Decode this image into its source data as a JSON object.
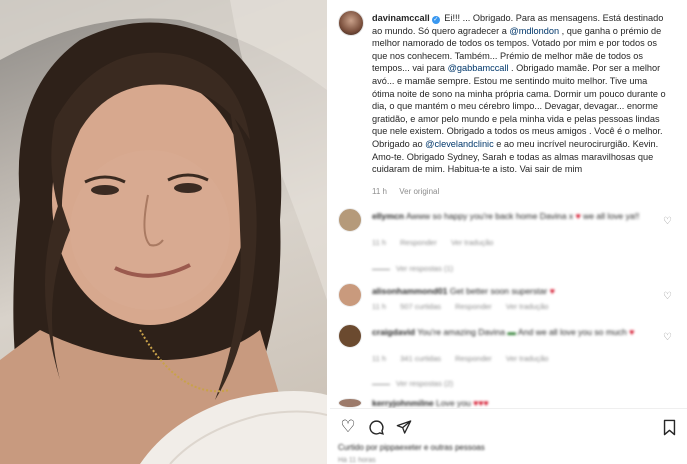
{
  "post": {
    "username": "davinamccall",
    "caption_parts": [
      {
        "type": "text",
        "value": " Ei!!! ... Obrigado. Para as mensagens. Está destinado ao mundo. Só quero agradecer a "
      },
      {
        "type": "mention",
        "value": "@mdlondon"
      },
      {
        "type": "text",
        "value": " , que ganha o prémio de melhor namorado de todos os tempos. Votado por mim e por todos os que nos conhecem. Também... Prémio de melhor mãe de todos os tempos... vai para "
      },
      {
        "type": "mention",
        "value": "@gabbamccall"
      },
      {
        "type": "text",
        "value": " . Obrigado mamãe. Por ser a melhor avó... e mamãe sempre. Estou me sentindo muito melhor. Tive uma ótima noite de sono na minha própria cama. Dormir um pouco durante o dia, o que mantém o meu cérebro limpo... Devagar, devagar... enorme gratidão, e amor pelo mundo e pela minha vida e pelas pessoas lindas que nele existem. Obrigado a todos os meus amigos . Você é o melhor. Obrigado ao "
      },
      {
        "type": "mention",
        "value": "@clevelandclinic"
      },
      {
        "type": "text",
        "value": " e ao meu incrível neurocirurgião. Kevin. Amo-te. Obrigado Sydney, Sarah e todas as almas maravilhosas que cuidaram de mim. Habitua-te a isto. Vai sair de mim"
      }
    ],
    "time_ago": "11 h",
    "see_original": "Ver original"
  },
  "comments": [
    {
      "username": "ellymcn",
      "text": "Awww so happy you're back home Davina x",
      "text_after_heart": " we all love ya!!",
      "avatar_color": "#b59a7a",
      "meta": [
        "11 h",
        "Responder",
        "Ver tradução"
      ],
      "replies_label": "Ver respostas (1)"
    },
    {
      "username": "alisonhammond01",
      "text": "Get better soon superstar",
      "text_after_heart": "",
      "avatar_color": "#c99a7d",
      "meta": [
        "11 h",
        "507 curtidas",
        "Responder",
        "Ver tradução"
      ],
      "replies_label": ""
    },
    {
      "username": "craigdavid",
      "text": "You're amazing Davina",
      "text_after_heart": " And we all love you so much",
      "avatar_color": "#6b4a2f",
      "meta": [
        "11 h",
        "341 curtidas",
        "Responder",
        "Ver tradução"
      ],
      "replies_label": "Ver respostas (2)"
    },
    {
      "username": "kerryjohnmilne",
      "text": "Love you",
      "text_after_heart": "",
      "avatar_color": "#9c7a6a",
      "meta": [],
      "replies_label": ""
    }
  ],
  "actions": {
    "like_icon": "heart-outline-icon",
    "comment_icon": "comment-icon",
    "share_icon": "share-icon",
    "save_icon": "bookmark-icon",
    "likes_text": "Curtido por pippaexeter e outras pessoas",
    "time_text": "Há 11 horas"
  },
  "colors": {
    "verified": "#3897f0",
    "heart": "#d0021b",
    "mention": "#00376b",
    "meta": "#8e8e8e"
  }
}
